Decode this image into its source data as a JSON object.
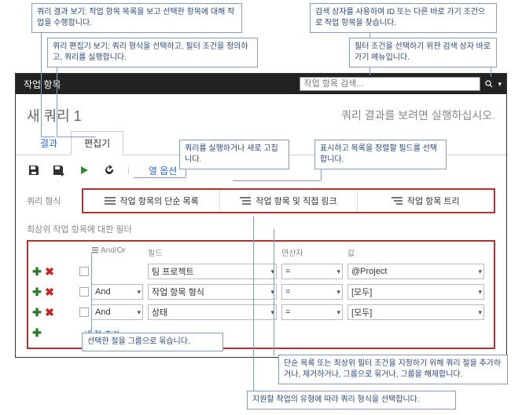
{
  "callouts": {
    "c1": "쿼리 결과 보기: 작업 항목 목록을 보고 선택한 항목에 대해 작업을 수행합니다.",
    "c2": "검색 상자를 사용하여 ID 또는 다른 바로 가기 조건으로 작업 항목을 찾습니다.",
    "c3": "쿼리 편집기 보기: 쿼리 형식을 선택하고, 필터 조건을 정의하고, 쿼리를 실행합니다.",
    "c4": "필터 조건을 선택하기 위한 검색 상자 바로 가기 메뉴입니다.",
    "c5": "쿼리를 실행하거나 새로 고칩니다.",
    "c6": "표시하고 목록을 정렬할 필드를 선택합니다.",
    "c7": "선택한 절을 그룹으로 묶습니다.",
    "c8": "단순 목록 또는 최상위 필터 조건을 지정하기 위해 쿼리 절을 추가하거나, 제거하거나, 그룹으로 묶거나, 그룹을 해제합니다.",
    "c9": "지원할 작업의 유형에 따라 쿼리 형식을 선택합니다."
  },
  "titlebar": {
    "title": "작업 항목",
    "search_placeholder": "작업 항목 검색..."
  },
  "header": {
    "query_name": "새 쿼리 1",
    "run_hint": "쿼리 결과를 보려면 실행하십시오."
  },
  "tabs": {
    "results": "결과",
    "editor": "편집기"
  },
  "toolbar": {
    "col_options": "열 옵션"
  },
  "query_format": {
    "label": "쿼리 형식",
    "b1": "작업 항목의 단순 목록",
    "b2": "작업 항목 및 직접 링크",
    "b3": "작업 항목 트리"
  },
  "filter_section_label": "최상위 작업 항목에 대한 필터",
  "grid": {
    "hdr_andor": "And/Or",
    "hdr_field": "필드",
    "hdr_op": "연산자",
    "hdr_val": "값",
    "rows": [
      {
        "andor": "",
        "field": "팀 프로젝트",
        "op": "=",
        "val": "@Project"
      },
      {
        "andor": "And",
        "field": "작업 항목 형식",
        "op": "=",
        "val": "[모두]"
      },
      {
        "andor": "And",
        "field": "상태",
        "op": "=",
        "val": "[모두]"
      }
    ],
    "add_clause": "새 절 추가"
  }
}
